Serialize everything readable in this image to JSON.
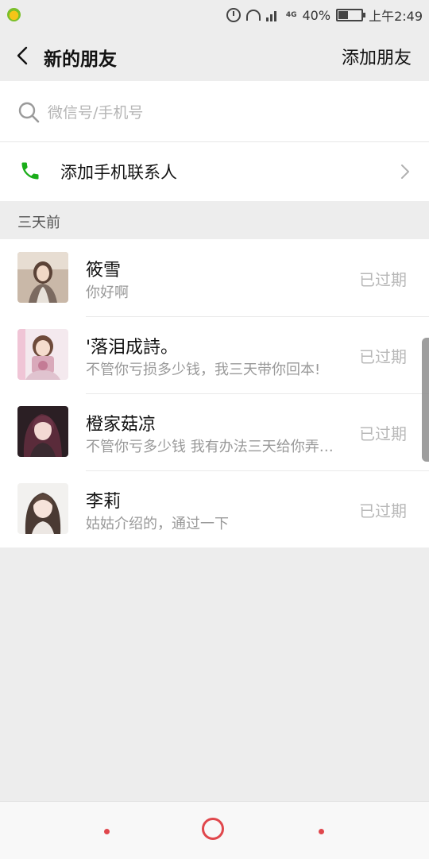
{
  "status_bar": {
    "network": "4G",
    "battery": "40%",
    "time": "上午2:49"
  },
  "header": {
    "title": "新的朋友",
    "add_friend_label": "添加朋友"
  },
  "search": {
    "placeholder": "微信号/手机号",
    "value": ""
  },
  "phone_contacts": {
    "label": "添加手机联系人"
  },
  "section_label": "三天前",
  "requests": [
    {
      "name": "筱雪",
      "message": "你好啊",
      "status": "已过期"
    },
    {
      "name": "'落泪成詩。",
      "message": "不管你亏损多少钱，我三天带你回本!",
      "status": "已过期"
    },
    {
      "name": "橙家菇凉",
      "message": "不管你亏多少钱 我有办法三天给你弄回本",
      "status": "已过期"
    },
    {
      "name": "李莉",
      "message": "姑姑介绍的，通过一下",
      "status": "已过期"
    }
  ],
  "colors": {
    "background": "#ededed",
    "phone_icon": "#1aad19",
    "nav_accent": "#e0474c",
    "expired_text": "#b8b8b8"
  },
  "icons": {
    "back": "chevron-left-icon",
    "search": "search-icon",
    "phone": "phone-icon",
    "chevron": "chevron-right-icon"
  }
}
